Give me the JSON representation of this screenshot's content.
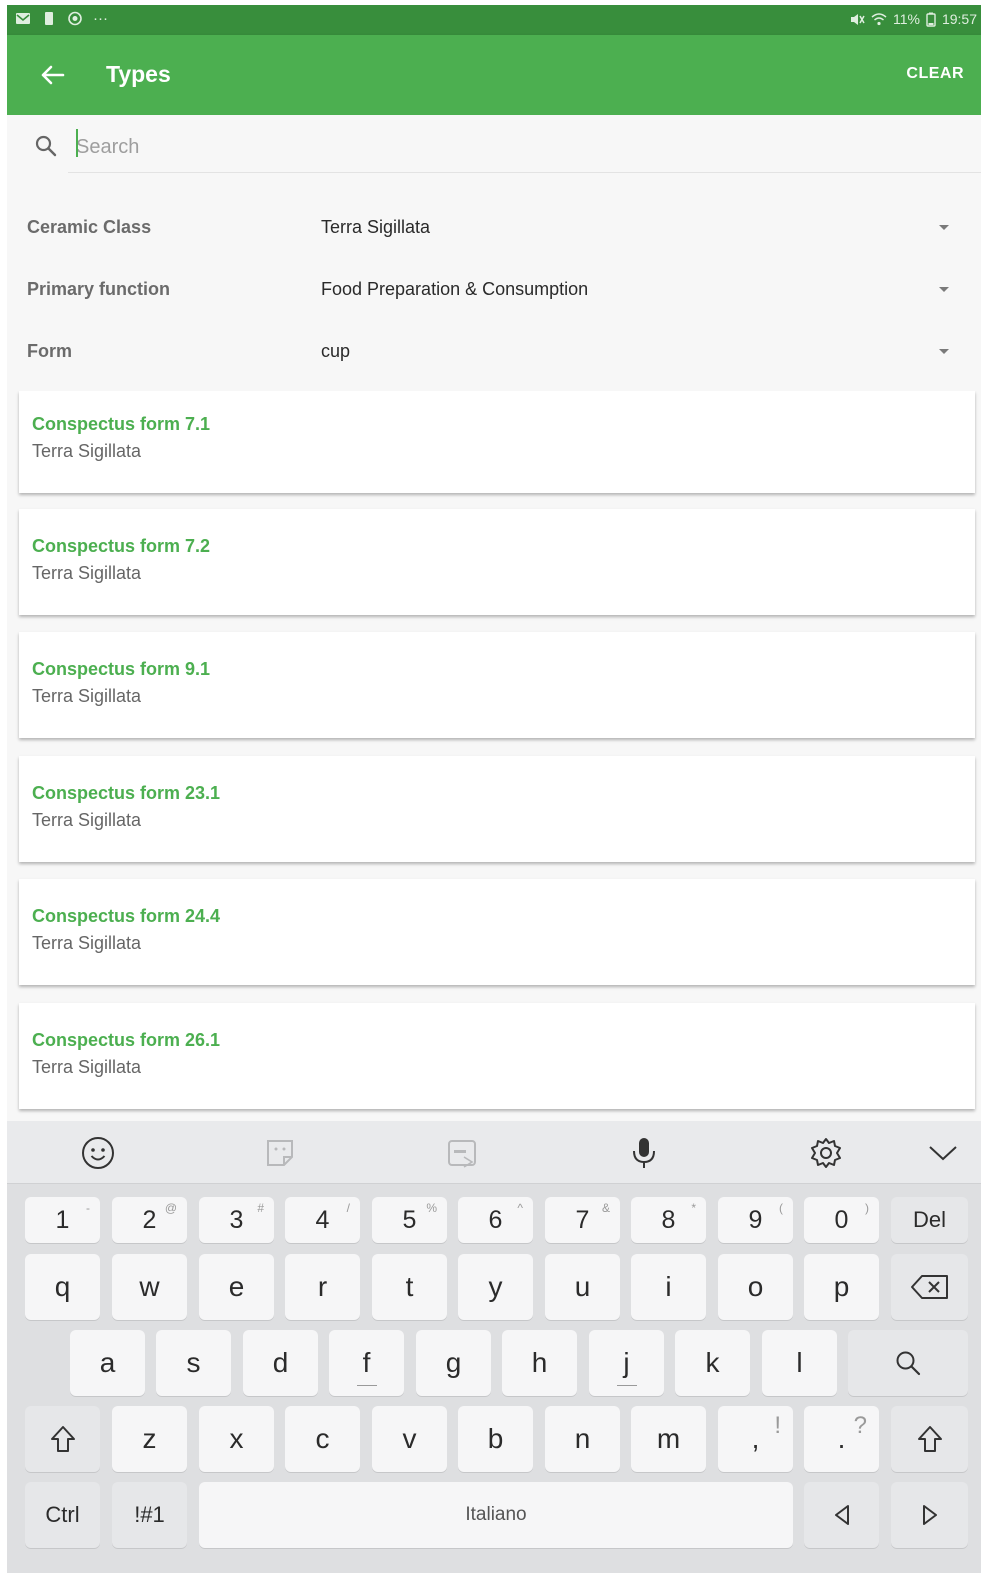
{
  "status_bar": {
    "left_more": "···",
    "battery_text": "11%",
    "time": "19:57"
  },
  "app_bar": {
    "title": "Types",
    "clear_label": "CLEAR"
  },
  "search": {
    "placeholder": "Search"
  },
  "filters": [
    {
      "label": "Ceramic Class",
      "value": "Terra Sigillata"
    },
    {
      "label": "Primary function",
      "value": "Food Preparation & Consumption"
    },
    {
      "label": "Form",
      "value": "cup"
    }
  ],
  "results": [
    {
      "title": "Conspectus form 7.1",
      "subtitle": "Terra Sigillata"
    },
    {
      "title": "Conspectus form 7.2",
      "subtitle": "Terra Sigillata"
    },
    {
      "title": "Conspectus form 9.1",
      "subtitle": "Terra Sigillata"
    },
    {
      "title": "Conspectus form 23.1",
      "subtitle": "Terra Sigillata"
    },
    {
      "title": "Conspectus form 24.4",
      "subtitle": "Terra Sigillata"
    },
    {
      "title": "Conspectus form 26.1",
      "subtitle": "Terra Sigillata"
    }
  ],
  "keyboard": {
    "toolbar_icons": [
      "emoji-icon",
      "sticker-icon",
      "gif-icon",
      "microphone-icon",
      "gear-icon",
      "chevron-down-icon"
    ],
    "number_row": [
      {
        "key": "1",
        "alt": "-"
      },
      {
        "key": "2",
        "alt": "@"
      },
      {
        "key": "3",
        "alt": "#"
      },
      {
        "key": "4",
        "alt": "/"
      },
      {
        "key": "5",
        "alt": "%"
      },
      {
        "key": "6",
        "alt": "^"
      },
      {
        "key": "7",
        "alt": "&"
      },
      {
        "key": "8",
        "alt": "*"
      },
      {
        "key": "9",
        "alt": "("
      },
      {
        "key": "0",
        "alt": ")"
      }
    ],
    "del_label": "Del",
    "row1": [
      "q",
      "w",
      "e",
      "r",
      "t",
      "y",
      "u",
      "i",
      "o",
      "p"
    ],
    "row2": [
      "a",
      "s",
      "d",
      "f",
      "g",
      "h",
      "j",
      "k",
      "l"
    ],
    "row3": [
      "z",
      "x",
      "c",
      "v",
      "b",
      "n",
      "m"
    ],
    "comma": {
      "key": ",",
      "alt": "!"
    },
    "period": {
      "key": ".",
      "alt": "?"
    },
    "ctrl_label": "Ctrl",
    "symbols_label": "!#1",
    "space_label": "Italiano",
    "accent_color": "#4caf50",
    "bar_color": "#388e3c"
  }
}
